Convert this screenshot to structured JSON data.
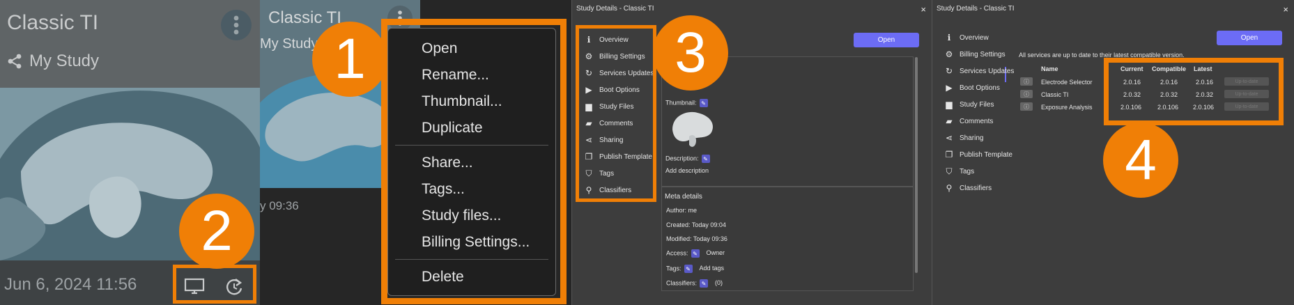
{
  "card": {
    "title": "Classic TI",
    "subtitle": "My Study",
    "date": "Jun 6, 2024 11:56",
    "modified_time": "y 09:36"
  },
  "badges": [
    "1",
    "2",
    "3",
    "4"
  ],
  "context_menu": {
    "group1": [
      "Open",
      "Rename...",
      "Thumbnail...",
      "Duplicate"
    ],
    "group2": [
      "Share...",
      "Tags...",
      "Study files...",
      "Billing Settings..."
    ],
    "group3": [
      "Delete"
    ]
  },
  "dialog": {
    "title": "Study Details - Classic TI",
    "close": "×",
    "open_label": "Open",
    "nav": [
      {
        "label": "Overview",
        "icon": "info-icon"
      },
      {
        "label": "Billing Settings",
        "icon": "gears-icon"
      },
      {
        "label": "Services Updates",
        "icon": "update-icon"
      },
      {
        "label": "Boot Options",
        "icon": "play-icon"
      },
      {
        "label": "Study Files",
        "icon": "file-icon"
      },
      {
        "label": "Comments",
        "icon": "comments-icon"
      },
      {
        "label": "Sharing",
        "icon": "share-icon"
      },
      {
        "label": "Publish Template",
        "icon": "copy-icon"
      },
      {
        "label": "Tags",
        "icon": "tags-icon"
      },
      {
        "label": "Classifiers",
        "icon": "search-icon"
      }
    ]
  },
  "overview": {
    "thumbnail_label": "Thumbnail:",
    "description_label": "Description:",
    "add_description": "Add description",
    "meta_title": "Meta details",
    "author": "Author:  me",
    "created": "Created:  Today 09:04",
    "modified": "Modified:  Today 09:36",
    "access_label": "Access:",
    "access_value": "Owner",
    "tags_label": "Tags:",
    "tags_value": "Add tags",
    "classifiers_label": "Classifiers:",
    "classifiers_value": "(0)"
  },
  "services": {
    "status": "All services are up to date to their latest compatible version.",
    "headers": [
      "Name",
      "Current",
      "Compatible",
      "Latest"
    ],
    "rows": [
      {
        "name": "Electrode Selector",
        "current": "2.0.16",
        "compatible": "2.0.16",
        "latest": "2.0.16"
      },
      {
        "name": "Classic TI",
        "current": "2.0.32",
        "compatible": "2.0.32",
        "latest": "2.0.32"
      },
      {
        "name": "Exposure Analysis",
        "current": "2.0.106",
        "compatible": "2.0.106",
        "latest": "2.0.106"
      }
    ],
    "update_label": "Up-to-date"
  },
  "colors": {
    "accent": "#f07f06",
    "primary_button": "#6c6cf5"
  }
}
